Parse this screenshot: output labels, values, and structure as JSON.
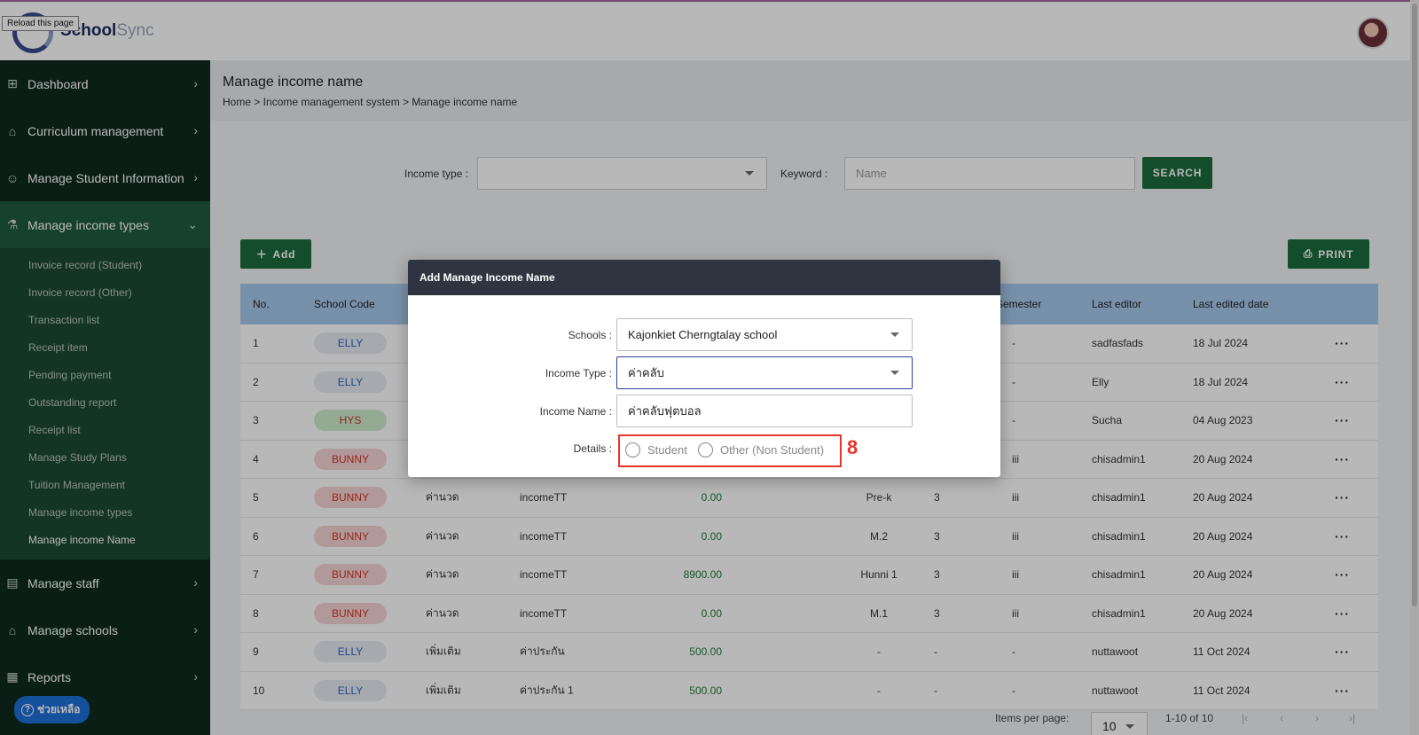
{
  "header": {
    "brand_bold": "School",
    "brand_light": "Sync",
    "tooltip": "Reload this page",
    "avatar_icon": "user-avatar"
  },
  "sidebar": {
    "items": [
      {
        "label": "Dashboard",
        "icon": "grid-icon"
      },
      {
        "label": "Curriculum management",
        "icon": "graduation-cap-icon"
      },
      {
        "label": "Manage Student Information",
        "icon": "student-icon"
      },
      {
        "label": "Manage income types",
        "icon": "flask-icon"
      }
    ],
    "subitems": [
      "Invoice record (Student)",
      "Invoice record (Other)",
      "Transaction list",
      "Receipt item",
      "Pending payment",
      "Outstanding report",
      "Receipt list",
      "Manage Study Plans",
      "Tuition Management",
      "Manage income types",
      "Manage income Name"
    ],
    "items_after": [
      {
        "label": "Manage staff",
        "icon": "id-card-icon"
      },
      {
        "label": "Manage schools",
        "icon": "school-icon"
      },
      {
        "label": "Reports",
        "icon": "report-icon"
      }
    ],
    "help_label": "ช่วยเหลือ"
  },
  "page": {
    "title": "Manage income name",
    "breadcrumb": "Home > Income management system > Manage income name"
  },
  "filters": {
    "income_type_label": "Income type :",
    "income_type_value": "",
    "keyword_label": "Keyword :",
    "keyword_placeholder": "Name",
    "search_label": "SEARCH"
  },
  "actions": {
    "add_label": "Add",
    "print_label": "PRINT"
  },
  "table": {
    "headers": [
      "No.",
      "School Code",
      "Semester",
      "Last editor",
      "Last edited date"
    ],
    "rows": [
      {
        "no": "1",
        "code": "ELLY",
        "c": "b-blue",
        "income_type": "",
        "income_name": "",
        "amount": "",
        "level": "",
        "year": "",
        "semester": "-",
        "editor": "sadfasfads",
        "date": "18 Jul 2024"
      },
      {
        "no": "2",
        "code": "ELLY",
        "c": "b-blue",
        "income_type": "",
        "income_name": "",
        "amount": "",
        "level": "",
        "year": "",
        "semester": "-",
        "editor": "Elly",
        "date": "18 Jul 2024"
      },
      {
        "no": "3",
        "code": "HYS",
        "c": "b-green",
        "income_type": "",
        "income_name": "",
        "amount": "",
        "level": "",
        "year": "",
        "semester": "-",
        "editor": "Sucha",
        "date": "04 Aug 2023"
      },
      {
        "no": "4",
        "code": "BUNNY",
        "c": "b-red",
        "income_type": "",
        "income_name": "",
        "amount": "",
        "level": "",
        "year": "",
        "semester": "iii",
        "editor": "chisadmin1",
        "date": "20 Aug 2024"
      },
      {
        "no": "5",
        "code": "BUNNY",
        "c": "b-red",
        "income_type": "ค่านวด",
        "income_name": "incomeTT",
        "amount": "0.00",
        "level": "Pre-k",
        "year": "3",
        "semester": "iii",
        "editor": "chisadmin1",
        "date": "20 Aug 2024"
      },
      {
        "no": "6",
        "code": "BUNNY",
        "c": "b-red",
        "income_type": "ค่านวด",
        "income_name": "incomeTT",
        "amount": "0.00",
        "level": "M.2",
        "year": "3",
        "semester": "iii",
        "editor": "chisadmin1",
        "date": "20 Aug 2024"
      },
      {
        "no": "7",
        "code": "BUNNY",
        "c": "b-red",
        "income_type": "ค่านวด",
        "income_name": "incomeTT",
        "amount": "8900.00",
        "level": "Hunni 1",
        "year": "3",
        "semester": "iii",
        "editor": "chisadmin1",
        "date": "20 Aug 2024"
      },
      {
        "no": "8",
        "code": "BUNNY",
        "c": "b-red",
        "income_type": "ค่านวด",
        "income_name": "incomeTT",
        "amount": "0.00",
        "level": "M.1",
        "year": "3",
        "semester": "iii",
        "editor": "chisadmin1",
        "date": "20 Aug 2024"
      },
      {
        "no": "9",
        "code": "ELLY",
        "c": "b-blue",
        "income_type": "เพิ่มเติม",
        "income_name": "ค่าประกัน",
        "amount": "500.00",
        "level": "-",
        "year": "-",
        "semester": "-",
        "editor": "nuttawoot",
        "date": "11 Oct 2024"
      },
      {
        "no": "10",
        "code": "ELLY",
        "c": "b-blue",
        "income_type": "เพิ่มเติม",
        "income_name": "ค่าประกัน 1",
        "amount": "500.00",
        "level": "-",
        "year": "-",
        "semester": "-",
        "editor": "nuttawoot",
        "date": "11 Oct 2024"
      }
    ],
    "row_menu": "···"
  },
  "pagination": {
    "items_per_page_label": "Items per page:",
    "items_per_page": "10",
    "range": "1-10 of 10",
    "first": "|‹",
    "prev": "‹",
    "next": "›",
    "last": "›|"
  },
  "modal": {
    "title": "Add Manage Income Name",
    "schools_label": "Schools :",
    "schools_value": "Kajonkiet Cherngtalay school",
    "income_type_label": "Income Type :",
    "income_type_value": "ค่าคลับ",
    "income_name_label": "Income Name :",
    "income_name_value": "ค่าคลับฟุตบอล",
    "details_label": "Details :",
    "radio_student": "Student",
    "radio_other": "Other (Non Student)",
    "step_number": "8"
  },
  "colors": {
    "sidebar_bg": "#0f2a1f",
    "accent_green": "#1c6b3c",
    "table_header": "#a7c9ee",
    "highlight_red": "#e8352b"
  }
}
